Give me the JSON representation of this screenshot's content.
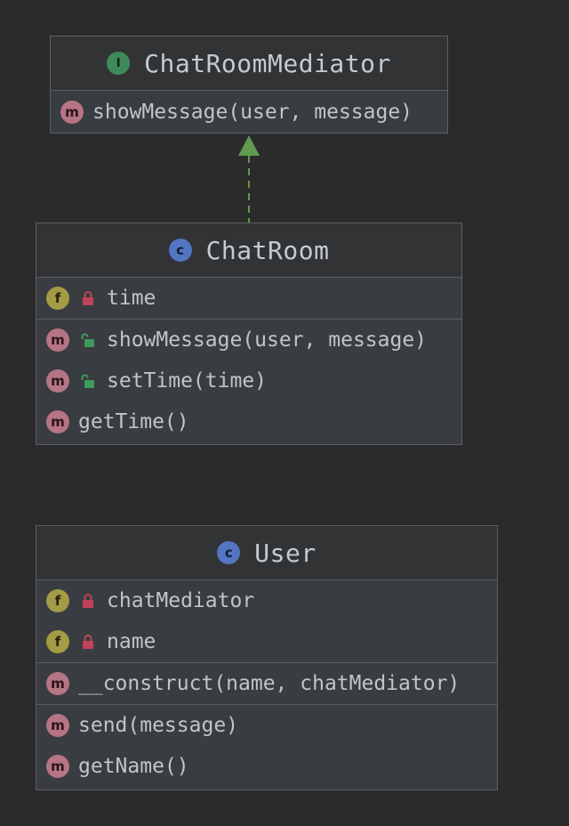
{
  "classes": {
    "mediator": {
      "name": "ChatRoomMediator",
      "badge": "I",
      "methods": [
        {
          "badge": "m",
          "label": "showMessage(user, message)"
        }
      ]
    },
    "chatroom": {
      "name": "ChatRoom",
      "badge": "c",
      "fields": [
        {
          "badge": "f",
          "visibility": "private-lock-icon",
          "label": "time"
        }
      ],
      "methods": [
        {
          "badge": "m",
          "visibility": "public-unlock-icon",
          "label": "showMessage(user, message)"
        },
        {
          "badge": "m",
          "visibility": "public-unlock-icon",
          "label": "setTime(time)"
        },
        {
          "badge": "m",
          "label": "getTime()"
        }
      ]
    },
    "user": {
      "name": "User",
      "badge": "c",
      "fields": [
        {
          "badge": "f",
          "visibility": "private-lock-icon",
          "label": "chatMediator"
        },
        {
          "badge": "f",
          "visibility": "private-lock-icon",
          "label": "name"
        }
      ],
      "constructors": [
        {
          "badge": "m",
          "label": "__construct(name, chatMediator)"
        }
      ],
      "methods": [
        {
          "badge": "m",
          "label": "send(message)"
        },
        {
          "badge": "m",
          "label": "getName()"
        }
      ]
    }
  },
  "colors": {
    "background": "#2b2b2b",
    "box": "#393c40",
    "header": "#313335",
    "border": "#5b5f64",
    "interface_badge": "#3f8a5a",
    "class_badge": "#5475c2",
    "method_badge": "#b57585",
    "field_badge": "#a39b45",
    "private_lock": "#c0435a",
    "public_lock": "#3f9a5e",
    "realization_arrow": "#5f9a4f"
  }
}
